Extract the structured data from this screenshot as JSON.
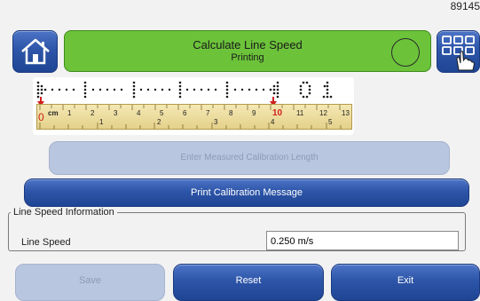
{
  "header": {
    "serial": "89145",
    "title": "Calculate Line Speed",
    "status": "Printing",
    "colors": {
      "header_bg": "#6cc33a",
      "button_blue": "#2d55a8"
    }
  },
  "icons": {
    "home": "home-icon",
    "apps": "grid-apps-icon",
    "hand": "hand-pointer-icon",
    "status": "status-circle-icon",
    "marker": "red-marker-icon"
  },
  "calibration": {
    "print_preview": "print-sample-dots-and-dashes",
    "ruler": {
      "cm_unit": "cm",
      "cm_labels": [
        "0",
        "1",
        "2",
        "3",
        "4",
        "5",
        "6",
        "7",
        "8",
        "9",
        "10",
        "11",
        "12",
        "13"
      ],
      "inch_labels": [
        "1",
        "2",
        "3",
        "4",
        "5"
      ],
      "highlight": [
        "0",
        "10"
      ],
      "highlight_color": "#d0201c"
    },
    "input_placeholder": "Enter Measured Calibration Length",
    "print_button": "Print Calibration Message"
  },
  "line_info": {
    "legend": "Line Speed Information",
    "label": "Line Speed",
    "value": "0.250 m/s"
  },
  "footer": {
    "save": "Save",
    "reset": "Reset",
    "exit": "Exit"
  }
}
